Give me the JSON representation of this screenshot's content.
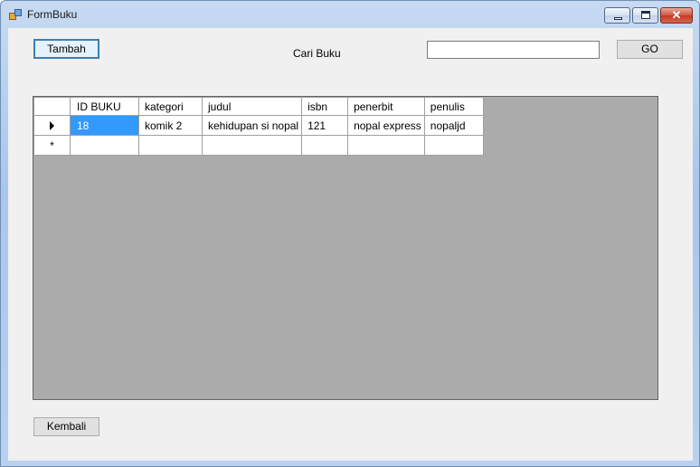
{
  "window": {
    "title": "FormBuku"
  },
  "toolbar": {
    "tambah_label": "Tambah",
    "cari_label": "Cari Buku",
    "search_value": "",
    "go_label": "GO"
  },
  "grid": {
    "columns": [
      "ID BUKU",
      "kategori",
      "judul",
      "isbn",
      "penerbit",
      "penulis"
    ],
    "rows": [
      [
        "18",
        "komik 2",
        "kehidupan si nopal",
        "121",
        "nopal express",
        "nopaljd"
      ]
    ],
    "new_row_marker": "*"
  },
  "footer": {
    "kembali_label": "Kembali"
  },
  "colors": {
    "selection": "#3399ff",
    "grid_background": "#ababab",
    "form_background": "#f0f0f0"
  }
}
